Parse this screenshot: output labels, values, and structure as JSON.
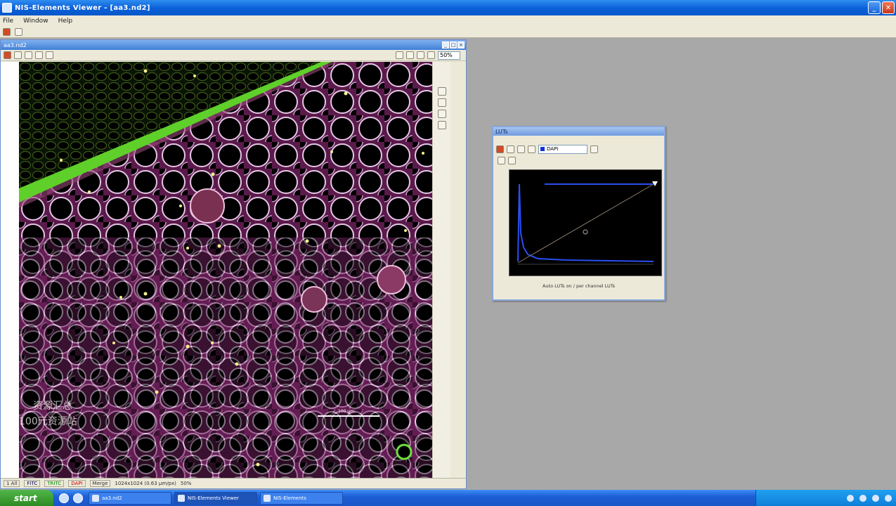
{
  "app": {
    "title": "NIS-Elements Viewer - [aa3.nd2]"
  },
  "menu": {
    "items": [
      "File",
      "Window",
      "Help"
    ]
  },
  "document": {
    "title": "aa3.nd2",
    "zoom": "50%",
    "scale_bar_label": "100 μm",
    "watermark_line1": "资源汇总",
    "watermark_line2": "100元资源站"
  },
  "statusbar": {
    "channels": [
      "1 All",
      "FITC",
      "TRITC",
      "DAPI",
      "Merge"
    ],
    "info": "1024x1024 (0.63 µm/px)",
    "zoom": "50%"
  },
  "luts": {
    "title": "LUTs",
    "channel": "DAPI",
    "footer": "Auto LUTs on / per channel LUTs"
  },
  "taskbar": {
    "start_label": "start",
    "tasks": [
      {
        "label": "aa3.nd2"
      },
      {
        "label": "NIS-Elements Viewer"
      },
      {
        "label": "NIS-Elements"
      }
    ]
  }
}
